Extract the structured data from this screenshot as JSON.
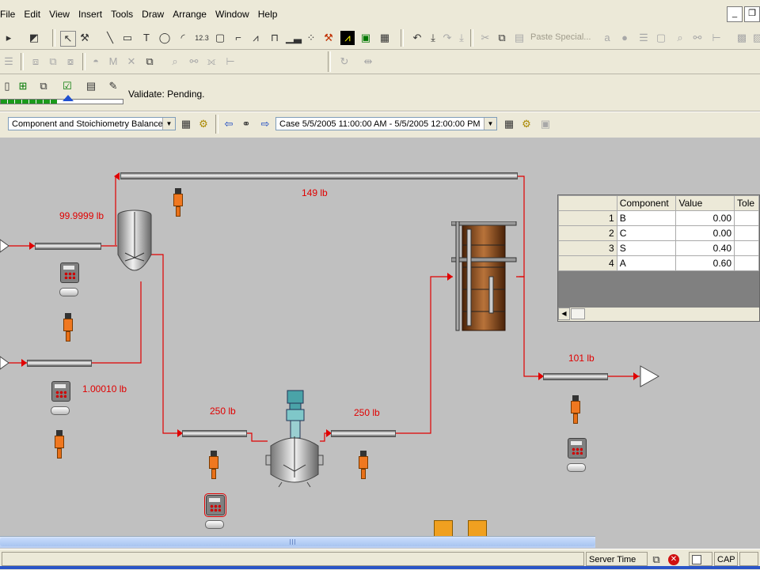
{
  "menu": [
    "File",
    "Edit",
    "View",
    "Insert",
    "Tools",
    "Draw",
    "Arrange",
    "Window",
    "Help"
  ],
  "toolbar": {
    "paste_special": "Paste Special...",
    "number_tool": "12.3",
    "text_tool": "T",
    "validate_status": "Validate: Pending."
  },
  "view_select": {
    "value": "Component and Stoichiometry Balance"
  },
  "case_select": {
    "value": "Case 5/5/2005 11:00:00 AM - 5/5/2005 12:00:00 PM"
  },
  "flow_labels": {
    "recycle": "149 lb",
    "feed_top": "99.9999 lb",
    "feed_bottom": "1.00010 lb",
    "reactor_in": "250 lb",
    "reactor_out": "250 lb",
    "product": "101 lb"
  },
  "component_table": {
    "headers": [
      "",
      "Component",
      "Value",
      "Tole"
    ],
    "rows": [
      {
        "n": "1",
        "component": "B",
        "value": "0.00"
      },
      {
        "n": "2",
        "component": "C",
        "value": "0.00"
      },
      {
        "n": "3",
        "component": "S",
        "value": "0.40"
      },
      {
        "n": "4",
        "component": "A",
        "value": "0.60"
      }
    ]
  },
  "status": {
    "server_time": "Server Time",
    "caps": "CAP"
  },
  "colors": {
    "stream": "#e00000",
    "chrome": "#ece9d8",
    "canvas": "#c0c0c0"
  }
}
